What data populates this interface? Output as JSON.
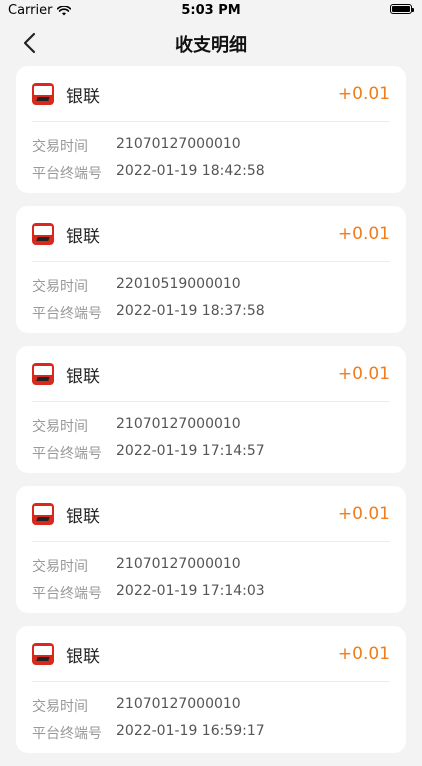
{
  "status_bar": {
    "carrier": "Carrier",
    "time": "5:03 PM"
  },
  "nav": {
    "title": "收支明细"
  },
  "records": [
    {
      "merchant": "银联",
      "amount": "+0.01",
      "label1": "交易时间",
      "value1": "21070127000010",
      "label2": "平台终端号",
      "value2": "2022-01-19 18:42:58"
    },
    {
      "merchant": "银联",
      "amount": "+0.01",
      "label1": "交易时间",
      "value1": "22010519000010",
      "label2": "平台终端号",
      "value2": "2022-01-19 18:37:58"
    },
    {
      "merchant": "银联",
      "amount": "+0.01",
      "label1": "交易时间",
      "value1": "21070127000010",
      "label2": "平台终端号",
      "value2": "2022-01-19 17:14:57"
    },
    {
      "merchant": "银联",
      "amount": "+0.01",
      "label1": "交易时间",
      "value1": "21070127000010",
      "label2": "平台终端号",
      "value2": "2022-01-19 17:14:03"
    },
    {
      "merchant": "银联",
      "amount": "+0.01",
      "label1": "交易时间",
      "value1": "21070127000010",
      "label2": "平台终端号",
      "value2": "2022-01-19 16:59:17"
    }
  ],
  "colors": {
    "amount": "#f07d1a",
    "logo": "#d9291c"
  },
  "icons": {
    "back": "chevron-left-icon",
    "wifi": "wifi-icon",
    "battery": "battery-icon",
    "logo": "unionpay-logo-icon"
  }
}
